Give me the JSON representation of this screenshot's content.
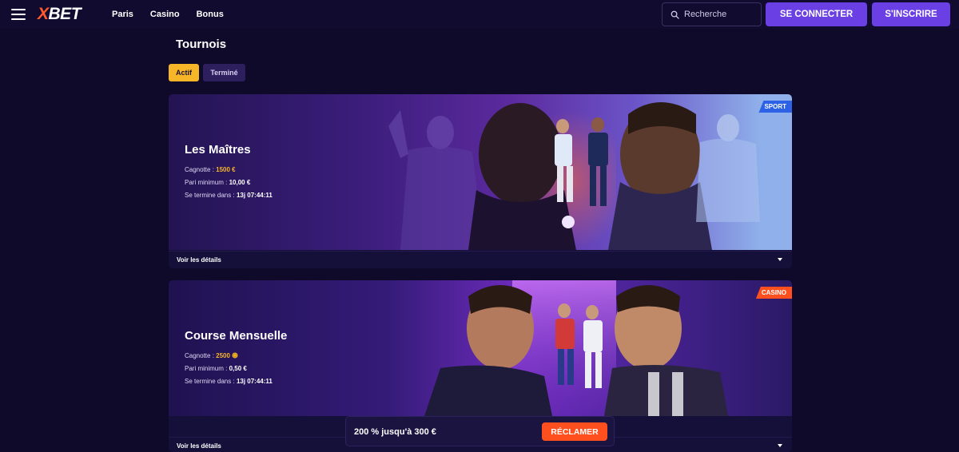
{
  "header": {
    "logo": {
      "part1": "X",
      "part2": "BET"
    },
    "nav": [
      "Paris",
      "Casino",
      "Bonus"
    ],
    "search": {
      "placeholder": "Recherche"
    },
    "login_label": "SE CONNECTER",
    "signup_label": "S'INSCRIRE"
  },
  "page": {
    "title": "Tournois",
    "tabs": [
      {
        "label": "Actif",
        "active": true
      },
      {
        "label": "Terminé",
        "active": false
      }
    ]
  },
  "tournaments": [
    {
      "title": "Les Maîtres",
      "tag": "SPORT",
      "prize_label": "Cagnotte :",
      "prize_value": "1500 €",
      "min_bet_label": "Pari minimum :",
      "min_bet_value": "10,00 €",
      "ends_label": "Se termine dans :",
      "ends_value": "13j 07:44:11",
      "details_label": "Voir les détails"
    },
    {
      "title": "Course Mensuelle",
      "tag": "CASINO",
      "prize_label": "Cagnotte :",
      "prize_value": "2500",
      "min_bet_label": "Pari minimum :",
      "min_bet_value": "0,50 €",
      "ends_label": "Se termine dans :",
      "ends_value": "13j 07:44:11",
      "details_label": "Voir les détails"
    }
  ],
  "promo": {
    "text": "200 % jusqu'à 300 €",
    "button_label": "RÉCLAMER"
  },
  "icons": {
    "menu": "hamburger-menu-icon",
    "search": "search-icon",
    "details": "chevron-down-icon",
    "coin": "coin-icon"
  },
  "colors": {
    "background": "#0f0a2a",
    "accent_purple": "#6a3fe4",
    "accent_gold": "#f7b528",
    "sport_tag": "#2e62e6",
    "casino_tag": "#ff4f1f"
  }
}
